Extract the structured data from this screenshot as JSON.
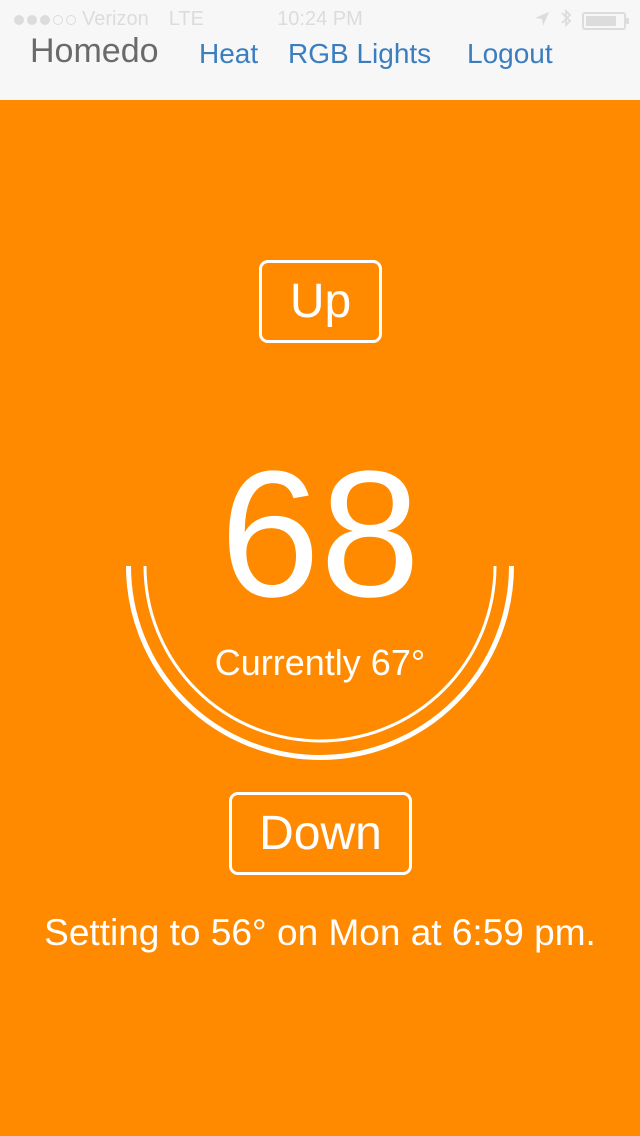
{
  "status_bar": {
    "carrier": "Verizon",
    "network": "LTE",
    "time": "10:24 PM",
    "signal_bars": 3,
    "signal_total": 5,
    "icons": [
      "location-arrow-icon",
      "bluetooth-icon",
      "battery-icon"
    ]
  },
  "nav": {
    "brand": "Homedo",
    "links": [
      "Heat",
      "RGB Lights",
      "Logout"
    ]
  },
  "thermostat": {
    "up_label": "Up",
    "setpoint": "68",
    "current": "Currently 67°",
    "down_label": "Down",
    "schedule": "Setting to 56° on Mon at 6:59 pm."
  },
  "colors": {
    "background": "#ff8a00",
    "topbar": "#f7f7f7",
    "link": "#3b7ec0",
    "brand": "#6a6a6a",
    "foreground": "#ffffff"
  }
}
